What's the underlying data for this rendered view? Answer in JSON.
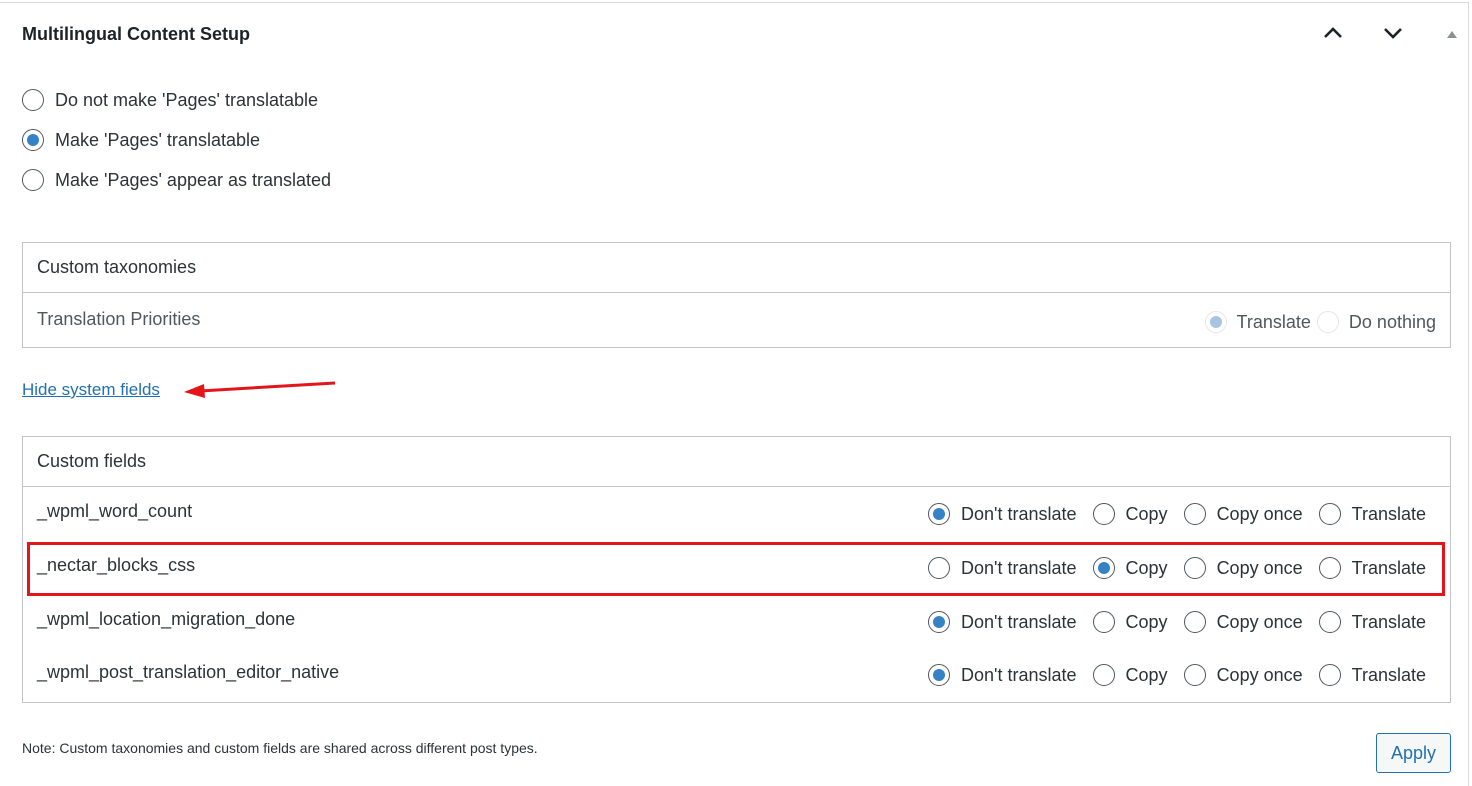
{
  "panel": {
    "title": "Multilingual Content Setup"
  },
  "translation_mode": {
    "options": [
      {
        "label": "Do not make 'Pages' translatable",
        "checked": false
      },
      {
        "label": "Make 'Pages' translatable",
        "checked": true
      },
      {
        "label": "Make 'Pages' appear as translated",
        "checked": false
      }
    ]
  },
  "taxonomies": {
    "header": "Custom taxonomies",
    "rows": [
      {
        "label": "Translation Priorities",
        "options": [
          "Translate",
          "Do nothing"
        ],
        "selected": "Translate",
        "disabled": true
      }
    ]
  },
  "hide_system_fields_link": "Hide system fields",
  "custom_fields": {
    "header": "Custom fields",
    "option_labels": [
      "Don't translate",
      "Copy",
      "Copy once",
      "Translate"
    ],
    "rows": [
      {
        "label": "_wpml_word_count",
        "selected": "Don't translate",
        "highlighted": false
      },
      {
        "label": "_nectar_blocks_css",
        "selected": "Copy",
        "highlighted": true
      },
      {
        "label": "_wpml_location_migration_done",
        "selected": "Don't translate",
        "highlighted": false
      },
      {
        "label": "_wpml_post_translation_editor_native",
        "selected": "Don't translate",
        "highlighted": false
      }
    ]
  },
  "note": "Note: Custom taxonomies and custom fields are shared across different post types.",
  "apply_label": "Apply",
  "colors": {
    "accent": "#2271b1",
    "radio_checked": "#3582c4",
    "annotation_red": "#e3151a"
  },
  "icons": {
    "move_up": "chevron-up-icon",
    "move_down": "chevron-down-icon",
    "toggle": "triangle-up-icon",
    "annotation": "arrow-left-icon"
  }
}
